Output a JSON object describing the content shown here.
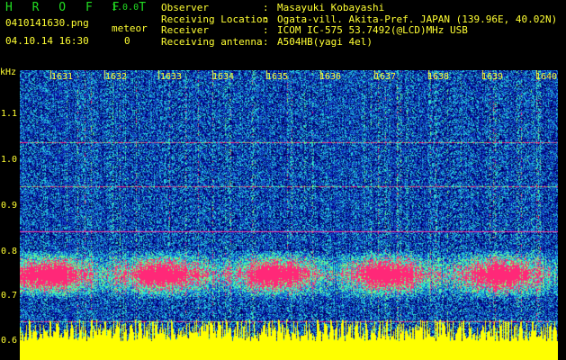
{
  "header": {
    "app_title": "H R O F F T",
    "app_version": "1.0.0",
    "file_name": "0410141630.png",
    "datetime": "04.10.14 16:30",
    "meteor_label": "meteor",
    "meteor_count": "0",
    "info": [
      {
        "label": "Observer",
        "value": "Masayuki Kobayashi"
      },
      {
        "label": "Receiving Location",
        "value": "Ogata-vill. Akita-Pref. JAPAN (139.96E, 40.02N)"
      },
      {
        "label": "Receiver",
        "value": "ICOM IC-575 53.7492(@LCD)MHz USB"
      },
      {
        "label": "Receiving antenna",
        "value": "A504HB(yagi 4el)"
      }
    ]
  },
  "axis": {
    "unit": "kHz",
    "y_ticks": [
      "1.1",
      "1.0",
      "0.9",
      "0.8",
      "0.7",
      "0.6"
    ],
    "x_ticks": [
      "1631",
      "1632",
      "1633",
      "1634",
      "1635",
      "1636",
      "1637",
      "1638",
      "1639",
      "1640"
    ]
  },
  "colors": {
    "text": "#ffff33",
    "title": "#22dd22",
    "background": "#000000",
    "noise_floor": "#1a2aa8",
    "signal_band": "#ff2a6e",
    "baseband": "#ffff00"
  }
}
